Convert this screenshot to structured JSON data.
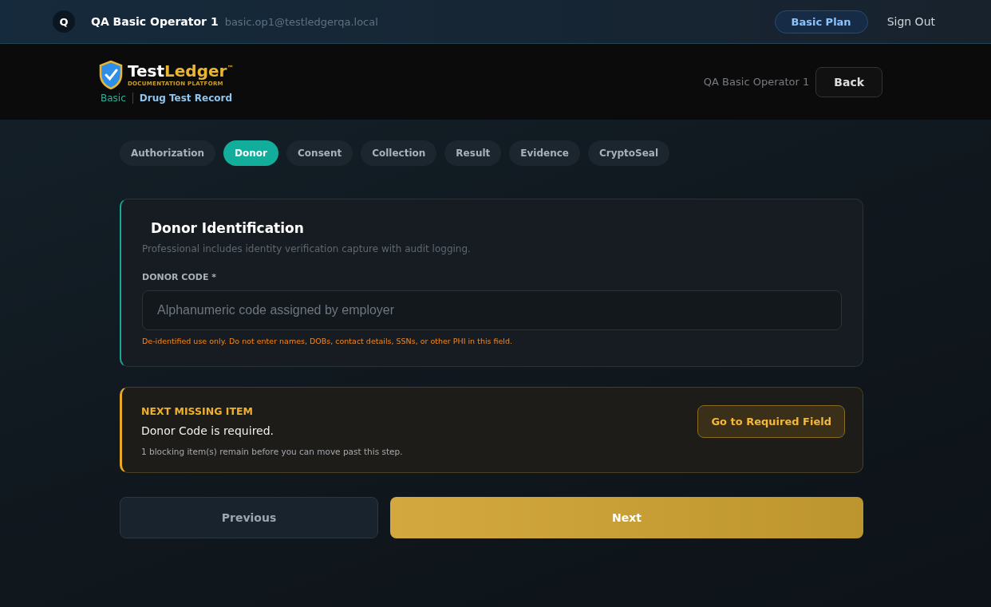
{
  "top_bar": {
    "avatar_letter": "Q",
    "user_name": "QA Basic Operator 1",
    "email": "basic.op1@testledgerqa.local",
    "plan_badge": "Basic Plan",
    "sign_out": "Sign Out"
  },
  "header": {
    "logo": {
      "word": "Test",
      "accent": "Ledger",
      "mark": "™",
      "tagline": "DOCUMENTATION PLATFORM"
    },
    "breadcrumb": [
      "Basic",
      "Drug Test Record"
    ],
    "operator": "QA Basic Operator 1",
    "back": "Back"
  },
  "tabs": [
    {
      "label": "Authorization",
      "selected": false
    },
    {
      "label": "Donor",
      "selected": true
    },
    {
      "label": "Consent",
      "selected": false
    },
    {
      "label": "Collection",
      "selected": false
    },
    {
      "label": "Result",
      "selected": false
    },
    {
      "label": "Evidence",
      "selected": false
    },
    {
      "label": "CryptoSeal",
      "selected": false
    }
  ],
  "section": {
    "title": "Donor Identification",
    "subtitle": "Professional includes identity verification capture with audit logging.",
    "field": {
      "label": "DONOR CODE *",
      "placeholder": "Alphanumeric code assigned by employer",
      "warning": "De-identified use only. Do not enter names, DOBs, contact details, SSNs, or other PHI in this field."
    }
  },
  "missing": {
    "heading": "NEXT MISSING ITEM",
    "message": "Donor Code is required.",
    "note": "1 blocking item(s) remain before you can move past this step.",
    "action": "Go to Required Field"
  },
  "nav": {
    "previous": "Previous",
    "next": "Next"
  }
}
